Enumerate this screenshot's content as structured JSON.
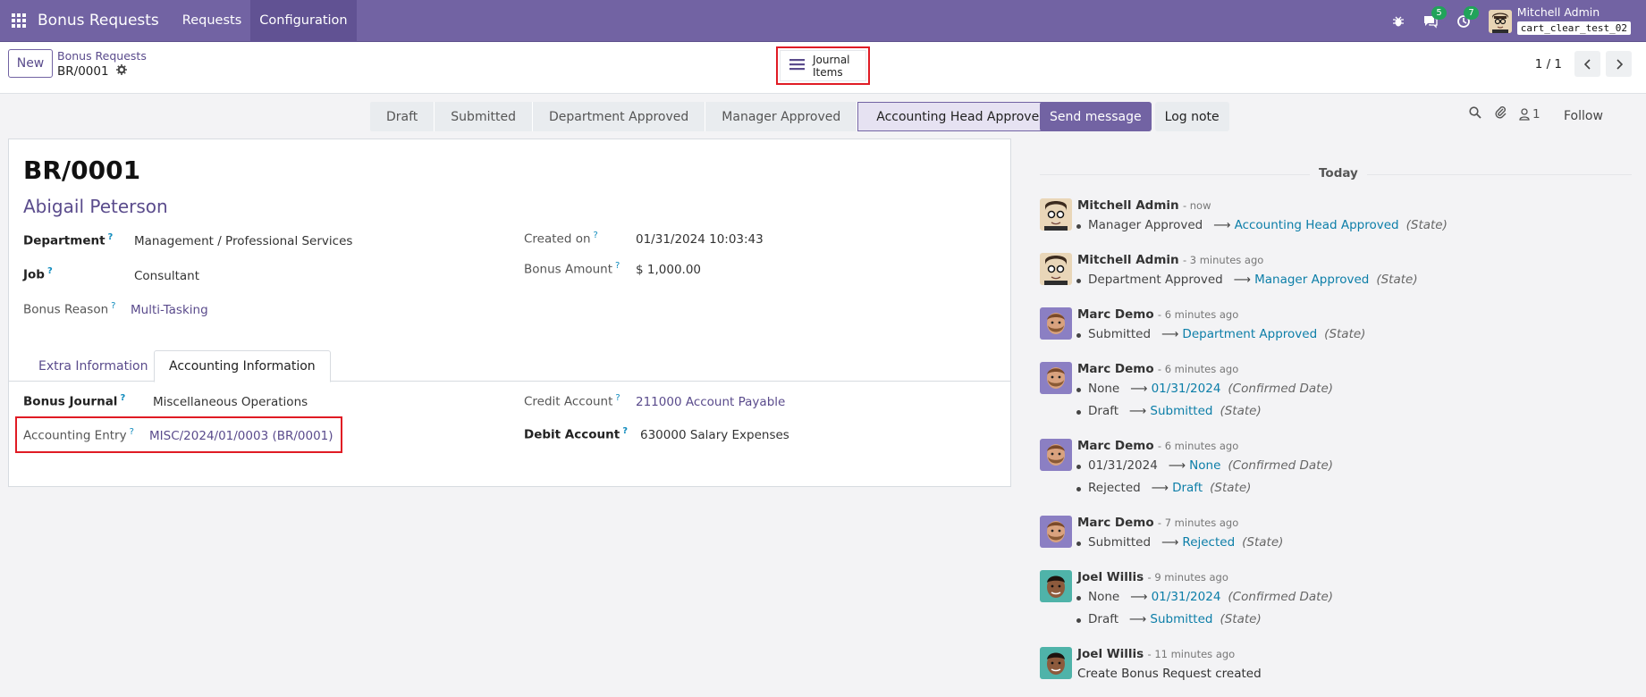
{
  "app": {
    "brand": "Bonus Requests",
    "menu": [
      "Requests",
      "Configuration"
    ],
    "activities_count": "5",
    "messages_count": "7",
    "user_name": "Mitchell Admin",
    "database": "cart_clear_test_02"
  },
  "control_panel": {
    "new_label": "New",
    "breadcrumb_parent": "Bonus Requests",
    "breadcrumb_current": "BR/0001",
    "smart_button_label": "Journal Items",
    "pager_value": "1 / 1"
  },
  "statusbar": {
    "stages": [
      "Draft",
      "Submitted",
      "Department Approved",
      "Manager Approved",
      "Accounting Head Approved"
    ],
    "current": "Accounting Head Approved"
  },
  "form": {
    "name": "BR/0001",
    "employee": "Abigail Peterson",
    "department_label": "Department",
    "department_value": "Management / Professional Services",
    "job_label": "Job",
    "job_value": "Consultant",
    "reason_label": "Bonus Reason",
    "reason_value": "Multi-Tasking",
    "created_label": "Created on",
    "created_value": "01/31/2024 10:03:43",
    "amount_label": "Bonus Amount",
    "amount_value": "$ 1,000.00",
    "tabs": [
      "Extra Information",
      "Accounting Information"
    ],
    "active_tab": "Accounting Information",
    "journal_label": "Bonus Journal",
    "journal_value": "Miscellaneous Operations",
    "entry_label": "Accounting Entry",
    "entry_value": "MISC/2024/01/0003 (BR/0001)",
    "credit_label": "Credit Account",
    "credit_value": "211000 Account Payable",
    "debit_label": "Debit Account",
    "debit_value": "630000 Salary Expenses"
  },
  "chatter": {
    "send_message": "Send message",
    "log_note": "Log note",
    "followers_count": "1",
    "follow": "Follow",
    "today": "Today",
    "messages": [
      {
        "author": "Mitchell Admin",
        "date": "- now",
        "avatar": "admin",
        "tracking": [
          {
            "old": "Manager Approved",
            "new": "Accounting Head Approved",
            "field": "(State)"
          }
        ]
      },
      {
        "author": "Mitchell Admin",
        "date": "- 3 minutes ago",
        "avatar": "admin",
        "tracking": [
          {
            "old": "Department Approved",
            "new": "Manager Approved",
            "field": "(State)"
          }
        ]
      },
      {
        "author": "Marc Demo",
        "date": "- 6 minutes ago",
        "avatar": "demo",
        "tracking": [
          {
            "old": "Submitted",
            "new": "Department Approved",
            "field": "(State)"
          }
        ]
      },
      {
        "author": "Marc Demo",
        "date": "- 6 minutes ago",
        "avatar": "demo",
        "tracking": [
          {
            "old": "None",
            "new": "01/31/2024",
            "field": "(Confirmed Date)"
          },
          {
            "old": "Draft",
            "new": "Submitted",
            "field": "(State)"
          }
        ]
      },
      {
        "author": "Marc Demo",
        "date": "- 6 minutes ago",
        "avatar": "demo",
        "tracking": [
          {
            "old": "01/31/2024",
            "new": "None",
            "field": "(Confirmed Date)"
          },
          {
            "old": "Rejected",
            "new": "Draft",
            "field": "(State)"
          }
        ]
      },
      {
        "author": "Marc Demo",
        "date": "- 7 minutes ago",
        "avatar": "demo",
        "tracking": [
          {
            "old": "Submitted",
            "new": "Rejected",
            "field": "(State)"
          }
        ]
      },
      {
        "author": "Joel Willis",
        "date": "- 9 minutes ago",
        "avatar": "joel",
        "tracking": [
          {
            "old": "None",
            "new": "01/31/2024",
            "field": "(Confirmed Date)"
          },
          {
            "old": "Draft",
            "new": "Submitted",
            "field": "(State)"
          }
        ]
      },
      {
        "author": "Joel Willis",
        "date": "- 11 minutes ago",
        "avatar": "joel",
        "body": "Create Bonus Request created"
      }
    ]
  },
  "colors": {
    "navbar": "#7263a3",
    "link": "#5a4b8c",
    "tracking_new": "#0c7ea8",
    "highlight": "#e01b24"
  }
}
